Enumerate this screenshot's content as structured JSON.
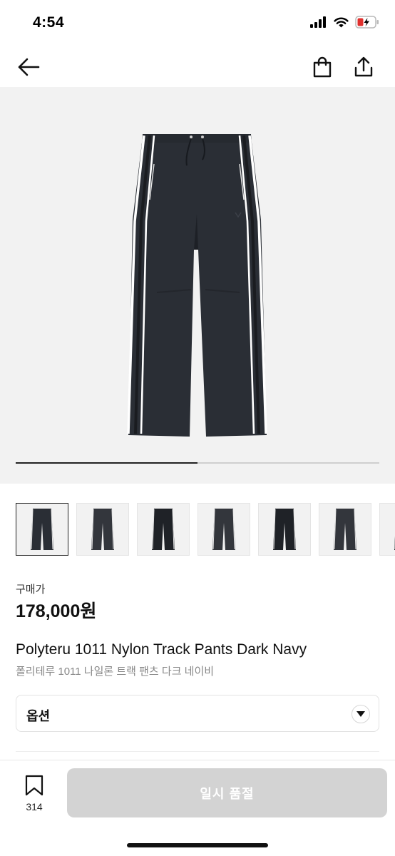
{
  "status_bar": {
    "time": "4:54",
    "icons": [
      "signal-icon",
      "wifi-icon",
      "battery-icon"
    ],
    "battery_color": "#e0302d"
  },
  "nav": {
    "back_icon": "back-arrow-icon",
    "cart_icon": "shopping-bag-icon",
    "share_icon": "share-icon"
  },
  "gallery": {
    "progress": 0.5,
    "thumbnail_count": 7
  },
  "product": {
    "price_label": "구매가",
    "price": "178,000원",
    "name_en": "Polyteru 1011 Nylon Track Pants Dark Navy",
    "name_ko": "폴리테루 1011 나일론 트랙 팬츠 다크 네이비"
  },
  "option": {
    "label": "옵션",
    "icon": "chevron-down-icon"
  },
  "bottom_bar": {
    "bookmark_icon": "bookmark-icon",
    "bookmark_count": "314",
    "buy_label": "일시 품절",
    "buy_color": "#d3d3d3"
  }
}
